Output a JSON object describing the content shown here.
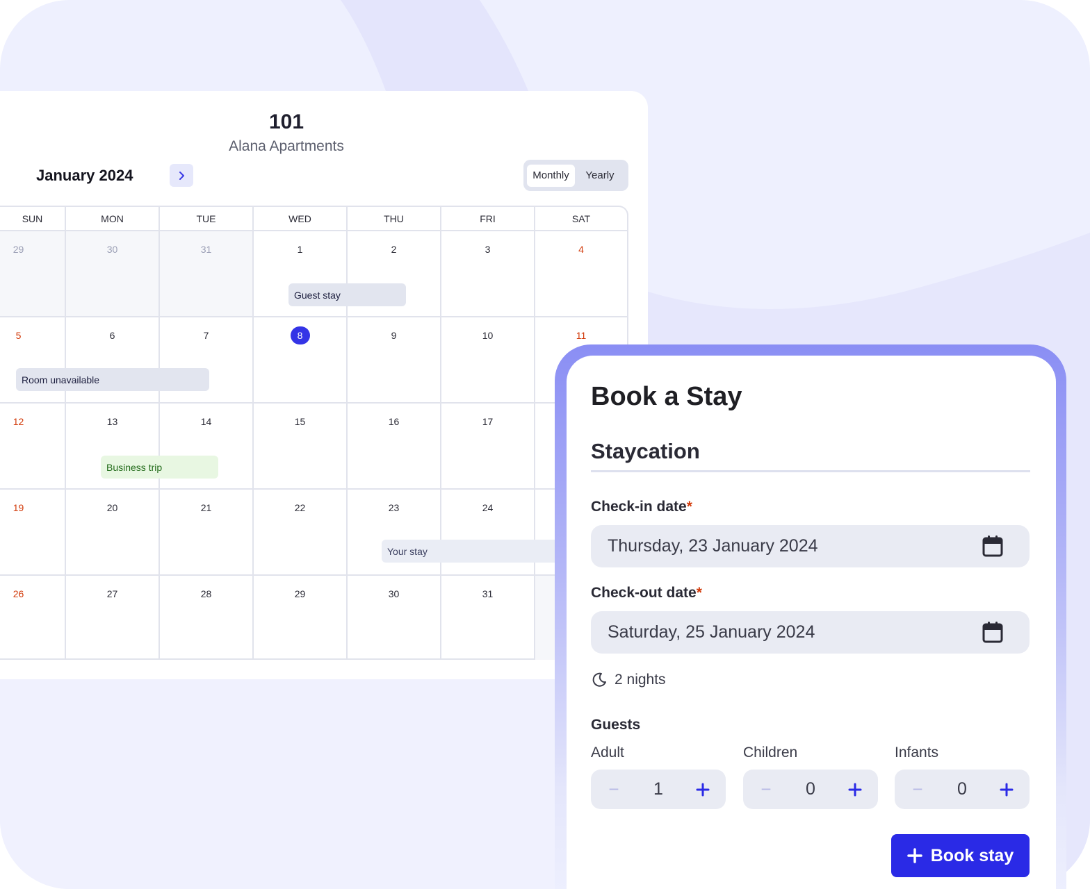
{
  "calendar": {
    "room_number": "101",
    "property_name": "Alana Apartments",
    "month_label": "January 2024",
    "next_icon": "chevron-right-icon",
    "views": {
      "monthly": "Monthly",
      "yearly": "Yearly",
      "active": "Monthly"
    },
    "weekdays": [
      "SUN",
      "MON",
      "TUE",
      "WED",
      "THU",
      "FRI",
      "SAT"
    ],
    "weeks": [
      [
        "29",
        "30",
        "31",
        "1",
        "2",
        "3",
        "4"
      ],
      [
        "5",
        "6",
        "7",
        "8",
        "9",
        "10",
        "11"
      ],
      [
        "12",
        "13",
        "14",
        "15",
        "16",
        "17",
        ""
      ],
      [
        "19",
        "20",
        "21",
        "22",
        "23",
        "24",
        ""
      ],
      [
        "26",
        "27",
        "28",
        "29",
        "30",
        "31",
        ""
      ]
    ],
    "today": "8",
    "events": {
      "guest_stay": "Guest stay",
      "room_unavailable": "Room unavailable",
      "business_trip": "Business trip",
      "your_stay": "Your stay"
    },
    "colors": {
      "weekend": "#d23a0a",
      "today": "#3434e6"
    }
  },
  "booking": {
    "title": "Book a Stay",
    "stay_name": "Staycation",
    "checkin_label": "Check-in date",
    "checkin_value": "Thursday, 23 January 2024",
    "checkout_label": "Check-out date",
    "checkout_value": "Saturday, 25 January 2024",
    "required_mark": "*",
    "nights": "2 nights",
    "guests_title": "Guests",
    "guests": {
      "adult": {
        "label": "Adult",
        "value": "1"
      },
      "children": {
        "label": "Children",
        "value": "0"
      },
      "infants": {
        "label": "Infants",
        "value": "0"
      }
    },
    "stepper_minus": "−",
    "submit_label": "Book stay",
    "accent": "#2a2ae6"
  }
}
